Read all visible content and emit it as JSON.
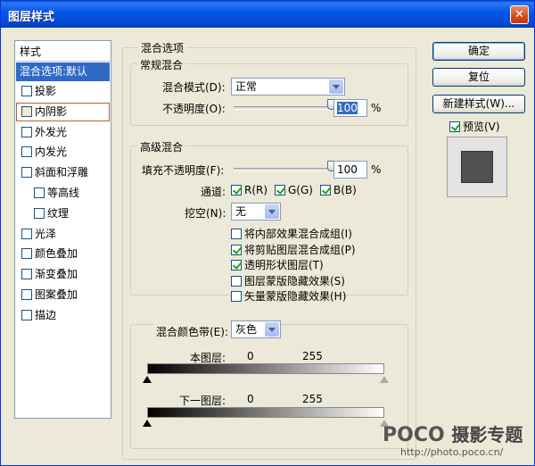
{
  "window": {
    "title": "图层样式",
    "close_glyph": "✕"
  },
  "sidebar": {
    "header": "样式",
    "selected": "混合选项:默认",
    "items": [
      {
        "label": "投影",
        "checked": false
      },
      {
        "label": "内阴影",
        "checked": false
      },
      {
        "label": "外发光",
        "checked": false
      },
      {
        "label": "内发光",
        "checked": false
      },
      {
        "label": "斜面和浮雕",
        "checked": false
      },
      {
        "label": "等高线",
        "checked": false
      },
      {
        "label": "纹理",
        "checked": false
      },
      {
        "label": "光泽",
        "checked": false
      },
      {
        "label": "颜色叠加",
        "checked": false
      },
      {
        "label": "渐变叠加",
        "checked": false
      },
      {
        "label": "图案叠加",
        "checked": false
      },
      {
        "label": "描边",
        "checked": false
      }
    ]
  },
  "blend_options": {
    "title": "混合选项",
    "general": {
      "title": "常规混合",
      "mode_label": "混合模式(D):",
      "mode_value": "正常",
      "opacity_label": "不透明度(O):",
      "opacity_value": "100",
      "opacity_unit": "%",
      "opacity_level": 1.0
    },
    "advanced": {
      "title": "高级混合",
      "fill_label": "填充不透明度(F):",
      "fill_value": "100",
      "fill_unit": "%",
      "fill_level": 1.0,
      "channels_label": "通道:",
      "channel_r": "R(R)",
      "channel_g": "G(G)",
      "channel_b": "B(B)",
      "knockout_label": "挖空(N):",
      "knockout_value": "无",
      "options": [
        {
          "label": "将内部效果混合成组(I)",
          "checked": false
        },
        {
          "label": "将剪贴图层混合成组(P)",
          "checked": true
        },
        {
          "label": "透明形状图层(T)",
          "checked": true
        },
        {
          "label": "图层蒙版隐藏效果(S)",
          "checked": false
        },
        {
          "label": "矢量蒙版隐藏效果(H)",
          "checked": false
        }
      ]
    },
    "blend_if": {
      "label": "混合颜色带(E):",
      "value": "灰色",
      "this_layer_label": "本图层:",
      "this_layer_min": "0",
      "this_layer_max": "255",
      "underlying_label": "下一图层:",
      "underlying_min": "0",
      "underlying_max": "255"
    }
  },
  "buttons": {
    "ok": "确定",
    "reset": "复位",
    "new_style": "新建样式(W)...",
    "preview_label": "预览(V)"
  },
  "watermark": {
    "brand": "POCO",
    "tagline": "摄影专题",
    "url": "http://photo.poco.cn/"
  }
}
